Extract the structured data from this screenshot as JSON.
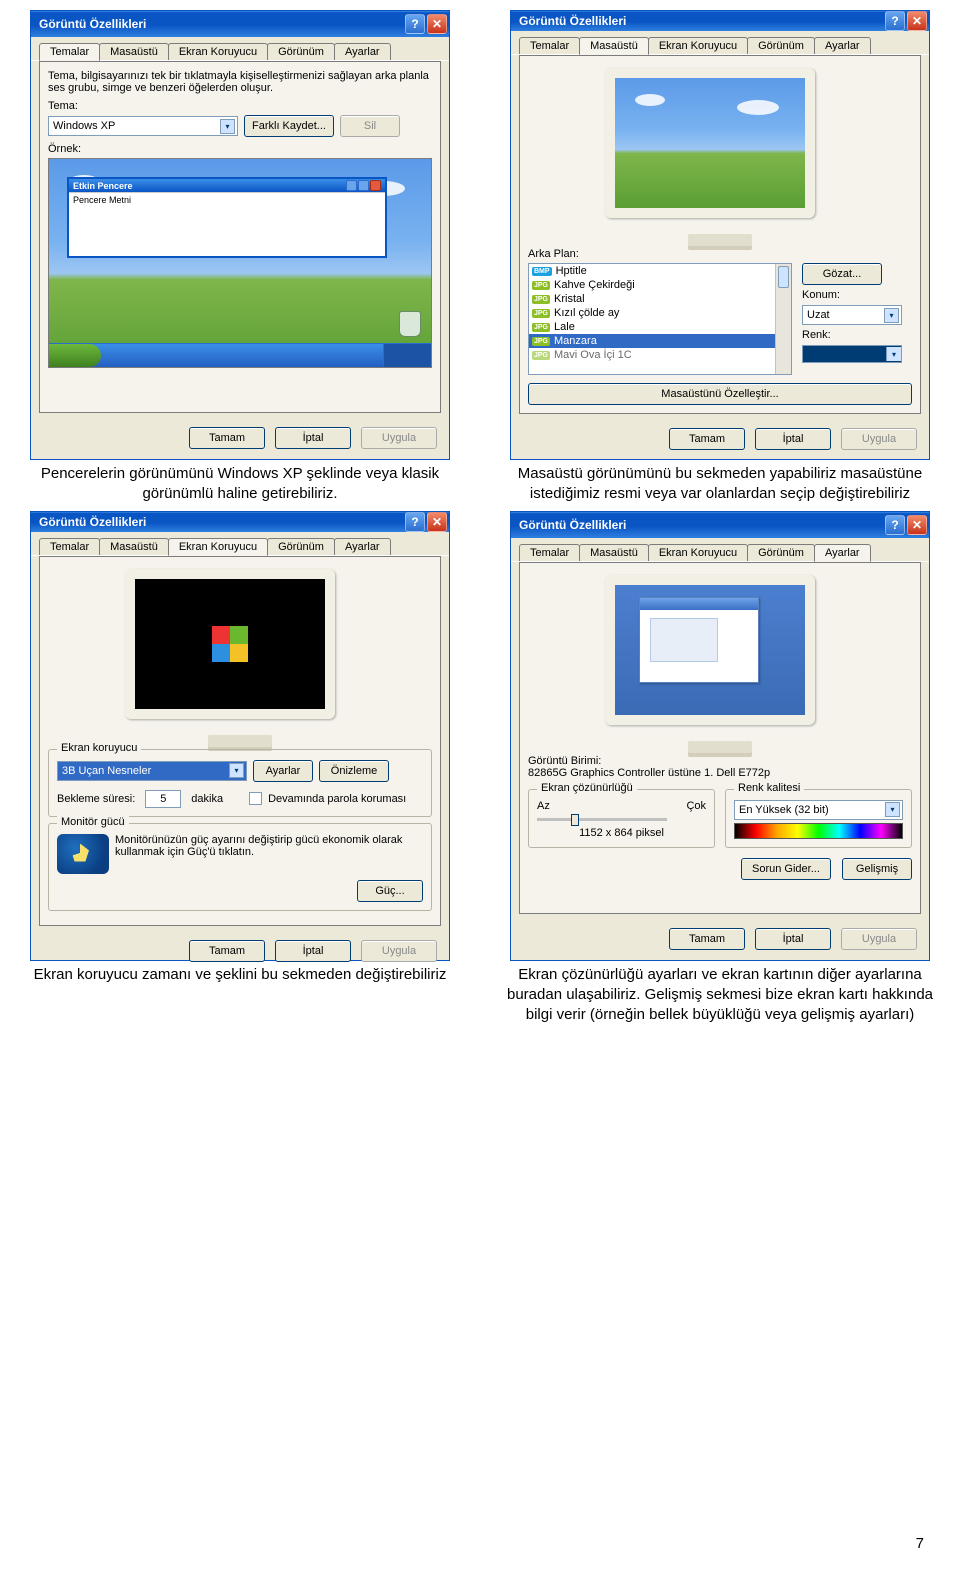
{
  "page_number": "7",
  "captions": {
    "themes": "Pencerelerin görünümünü Windows XP şeklinde veya klasik görünümlü haline getirebiliriz.",
    "desktop": "Masaüstü görünümünü bu sekmeden yapabiliriz masaüstüne istediğimiz resmi veya var olanlardan seçip değiştirebiliriz",
    "screensaver": "Ekran koruyucu zamanı ve şeklini bu sekmeden değiştirebiliriz",
    "settings": "Ekran çözünürlüğü ayarları ve ekran kartının diğer ayarlarına buradan ulaşabiliriz. Gelişmiş sekmesi bize ekran kartı hakkında bilgi verir (örneğin bellek büyüklüğü veya gelişmiş ayarları)"
  },
  "common": {
    "window_title": "Görüntü Özellikleri",
    "tabs": [
      "Temalar",
      "Masaüstü",
      "Ekran Koruyucu",
      "Görünüm",
      "Ayarlar"
    ],
    "ok": "Tamam",
    "cancel": "İptal",
    "apply": "Uygula"
  },
  "themes": {
    "intro": "Tema, bilgisayarınızı tek bir tıklatmayla kişiselleştirmenizi sağlayan arka planla ses grubu, simge ve benzeri öğelerden oluşur.",
    "theme_label": "Tema:",
    "theme_value": "Windows XP",
    "save_as": "Farklı Kaydet...",
    "delete": "Sil",
    "sample_label": "Örnek:",
    "active_window": "Etkin Pencere",
    "window_text": "Pencere Metni"
  },
  "desktop": {
    "bg_label": "Arka Plan:",
    "items": [
      {
        "type": "bmp",
        "name": "Hptitle"
      },
      {
        "type": "jpg",
        "name": "Kahve Çekirdeği"
      },
      {
        "type": "jpg",
        "name": "Kristal"
      },
      {
        "type": "jpg",
        "name": "Kızıl çölde ay"
      },
      {
        "type": "jpg",
        "name": "Lale"
      },
      {
        "type": "jpg",
        "name": "Manzara",
        "selected": true
      },
      {
        "type": "jpg",
        "name": "Mavi Ova İçi 1C"
      }
    ],
    "browse": "Gözat...",
    "position_label": "Konum:",
    "position_value": "Uzat",
    "color_label": "Renk:",
    "customize": "Masaüstünü Özelleştir..."
  },
  "screensaver": {
    "ss_group": "Ekran koruyucu",
    "ss_value": "3B Uçan Nesneler",
    "settings_btn": "Ayarlar",
    "preview_btn": "Önizleme",
    "wait_label": "Bekleme süresi:",
    "wait_value": "5",
    "wait_unit": "dakika",
    "pw_label": "Devamında parola koruması",
    "power_group": "Monitör gücü",
    "power_text": "Monitörünüzün güç ayarını değiştirip gücü ekonomik olarak kullanmak için Güç'ü tıklatın.",
    "power_btn": "Güç..."
  },
  "settings": {
    "adapter_label": "Görüntü Birimi:",
    "adapter_value": "82865G Graphics Controller üstüne 1. Dell E772p",
    "res_group": "Ekran çözünürlüğü",
    "less": "Az",
    "more": "Çok",
    "res_value": "1152 x 864 piksel",
    "color_group": "Renk kalitesi",
    "color_value": "En Yüksek (32 bit)",
    "troubleshoot": "Sorun Gider...",
    "advanced": "Gelişmiş"
  }
}
